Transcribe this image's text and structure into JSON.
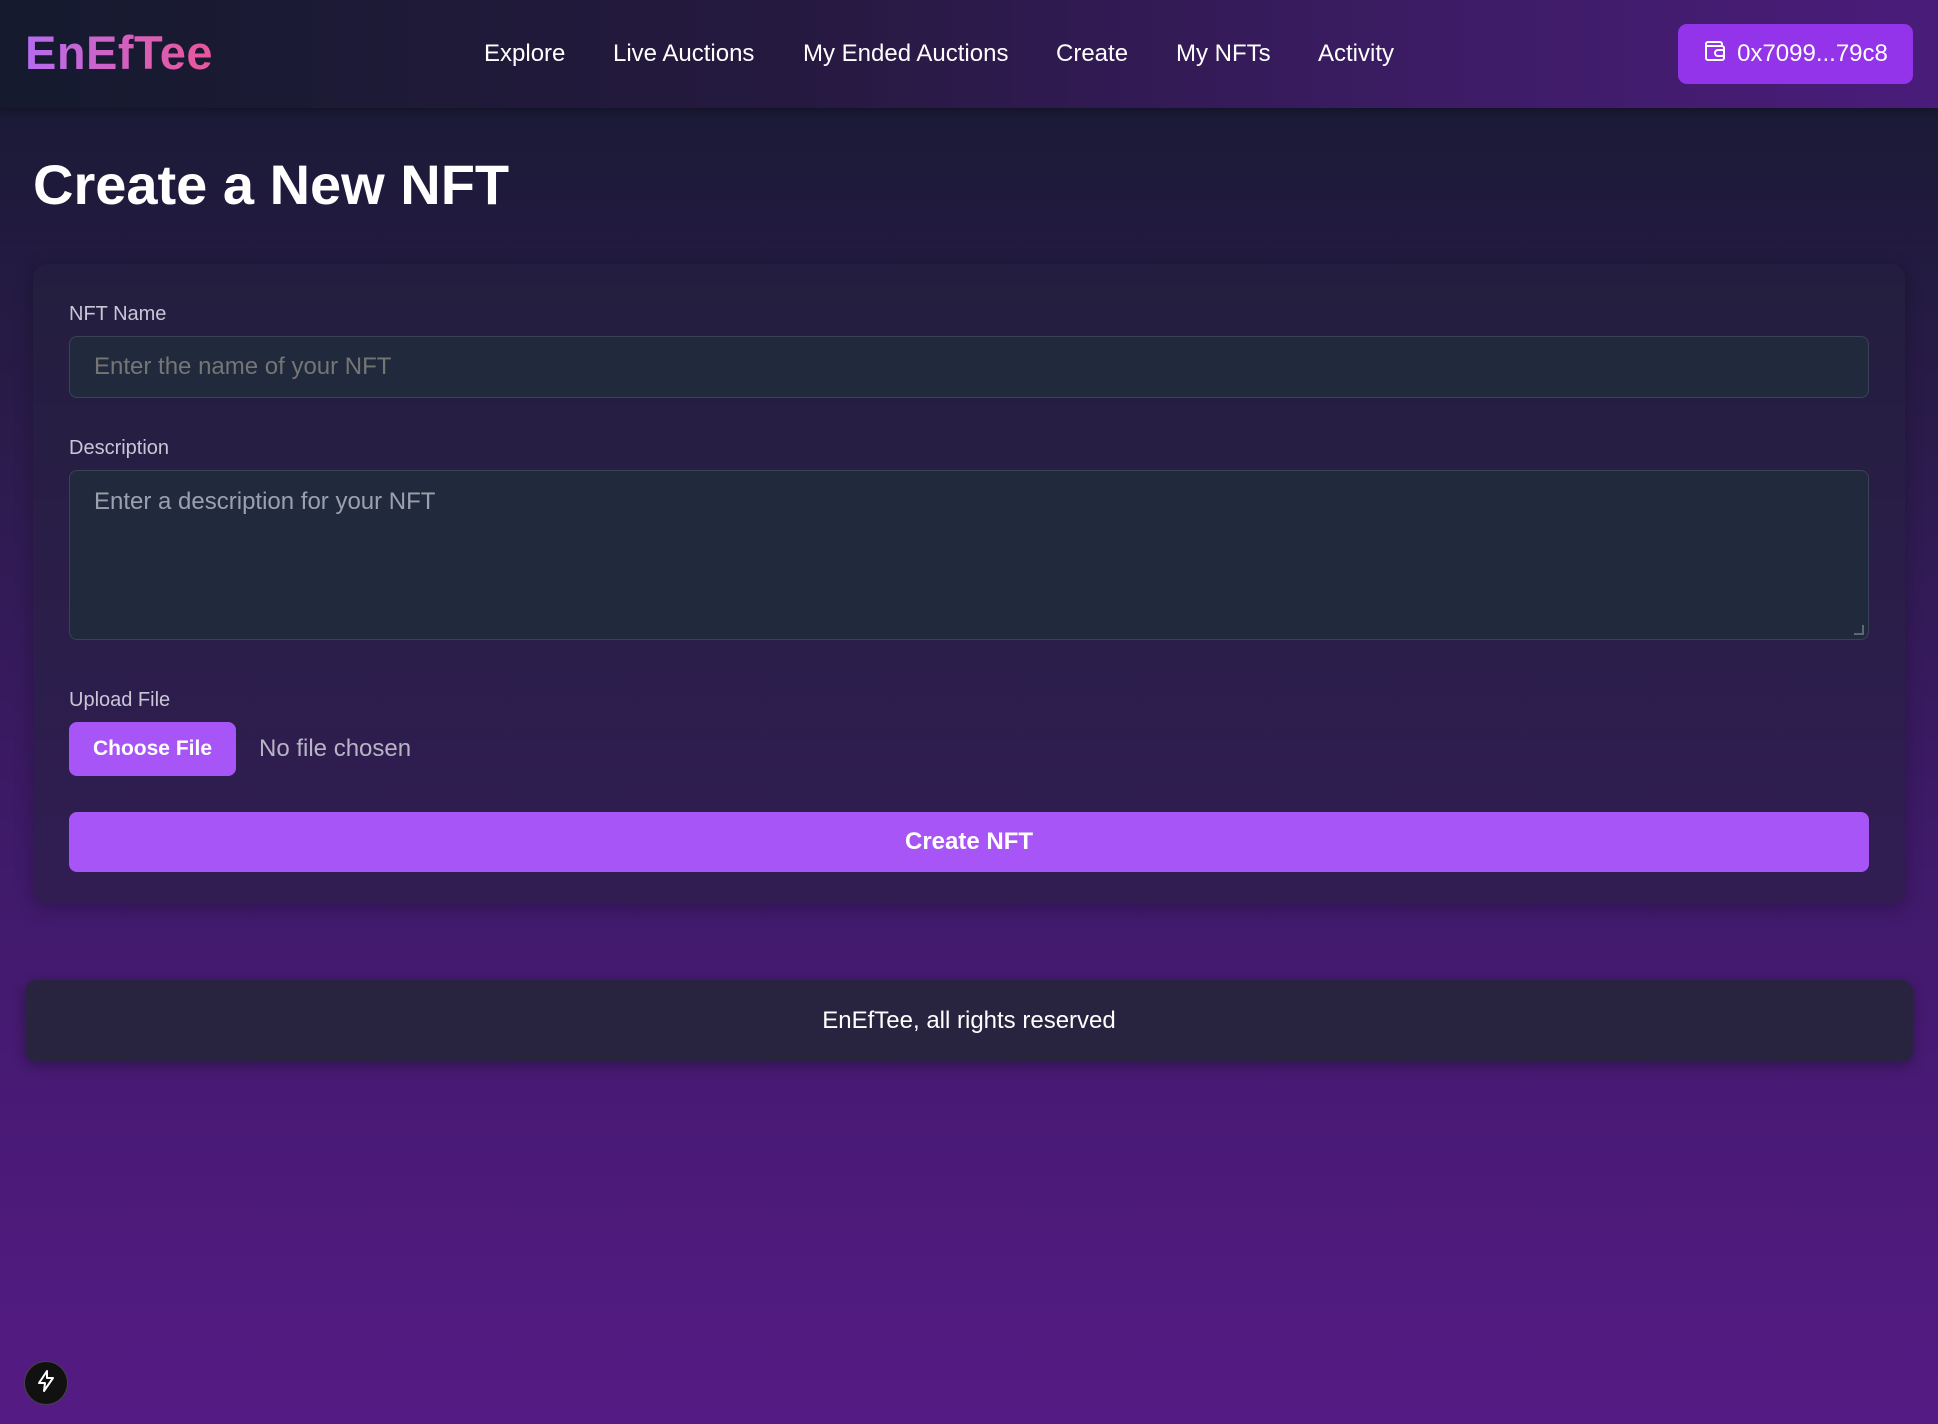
{
  "brand": {
    "logo_text": "EnEfTee"
  },
  "nav": {
    "items": [
      {
        "label": "Explore"
      },
      {
        "label": "Live Auctions"
      },
      {
        "label": "My Ended Auctions"
      },
      {
        "label": "Create"
      },
      {
        "label": "My NFTs"
      },
      {
        "label": "Activity"
      }
    ]
  },
  "wallet": {
    "address": "0x7099...79c8",
    "icon": "wallet-icon"
  },
  "page": {
    "title": "Create a New NFT"
  },
  "form": {
    "name_label": "NFT Name",
    "name_placeholder": "Enter the name of your NFT",
    "name_value": "",
    "description_label": "Description",
    "description_placeholder": "Enter a description for your NFT",
    "description_value": "",
    "upload_label": "Upload File",
    "choose_file_label": "Choose File",
    "file_status": "No file chosen",
    "submit_label": "Create NFT"
  },
  "footer": {
    "text": "EnEfTee, all rights reserved"
  },
  "colors": {
    "accent": "#a855f7",
    "wallet_button": "#9333ea",
    "input_bg": "#212a3c",
    "footer_bg": "#28243f"
  },
  "badge": {
    "icon": "bolt-icon"
  }
}
